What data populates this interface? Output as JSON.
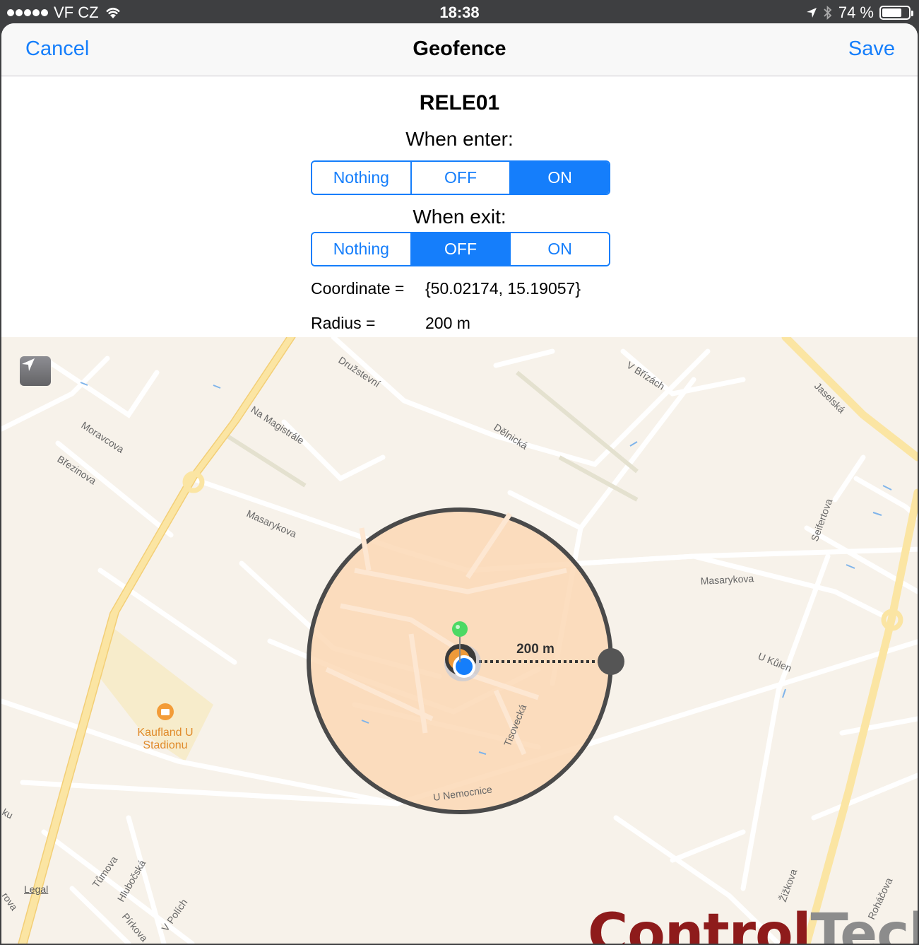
{
  "status_bar": {
    "carrier": "VF CZ",
    "time": "18:38",
    "battery": "74 %",
    "battery_level": 0.74
  },
  "nav": {
    "cancel_label": "Cancel",
    "title": "Geofence",
    "save_label": "Save"
  },
  "form": {
    "device_name": "RELE01",
    "enter_label": "When enter:",
    "exit_label": "When exit:",
    "enter_options": [
      "Nothing",
      "OFF",
      "ON"
    ],
    "enter_selected": "ON",
    "exit_options": [
      "Nothing",
      "OFF",
      "ON"
    ],
    "exit_selected": "OFF",
    "coordinate_label": "Coordinate =",
    "coordinate_value": "{50.02174, 15.19057}",
    "radius_label": "Radius =",
    "radius_value": "200 m"
  },
  "map": {
    "radius_overlay_label": "200 m",
    "legal_label": "Legal",
    "poi_label_line1": "Kaufland U",
    "poi_label_line2": "Stadionu",
    "street_labels": {
      "druzstevni": "Družstevní",
      "v_brizach": "V Břízách",
      "jaselska": "Jaselská",
      "na_magistrale": "Na Magistrále",
      "moravcova": "Moravcova",
      "brezinova": "Březinova",
      "delnicka": "Dělnická",
      "masarykova_w": "Masarykova",
      "masarykova_e": "Masarykova",
      "seifertova": "Seifertova",
      "u_kulen": "U Kůlen",
      "tisovecka": "Tisovecká",
      "u_nemocnice": "U Nemocnice",
      "tumova": "Tůmova",
      "hlubocska": "Hlubočská",
      "pirkova": "Pírkova",
      "v_polich": "V Polích",
      "zizkova": "Žižkova",
      "rohacova": "Roháčova",
      "ku": "ku",
      "rova": "rova"
    },
    "colors": {
      "fence_fill": "#fbd8b5",
      "fence_stroke": "#4a4a4a",
      "user_dot": "#157efb",
      "pin": "#4cd964",
      "major_road": "#fce7a6"
    }
  },
  "watermark": {
    "part1": "Control",
    "part2": "Tech"
  }
}
